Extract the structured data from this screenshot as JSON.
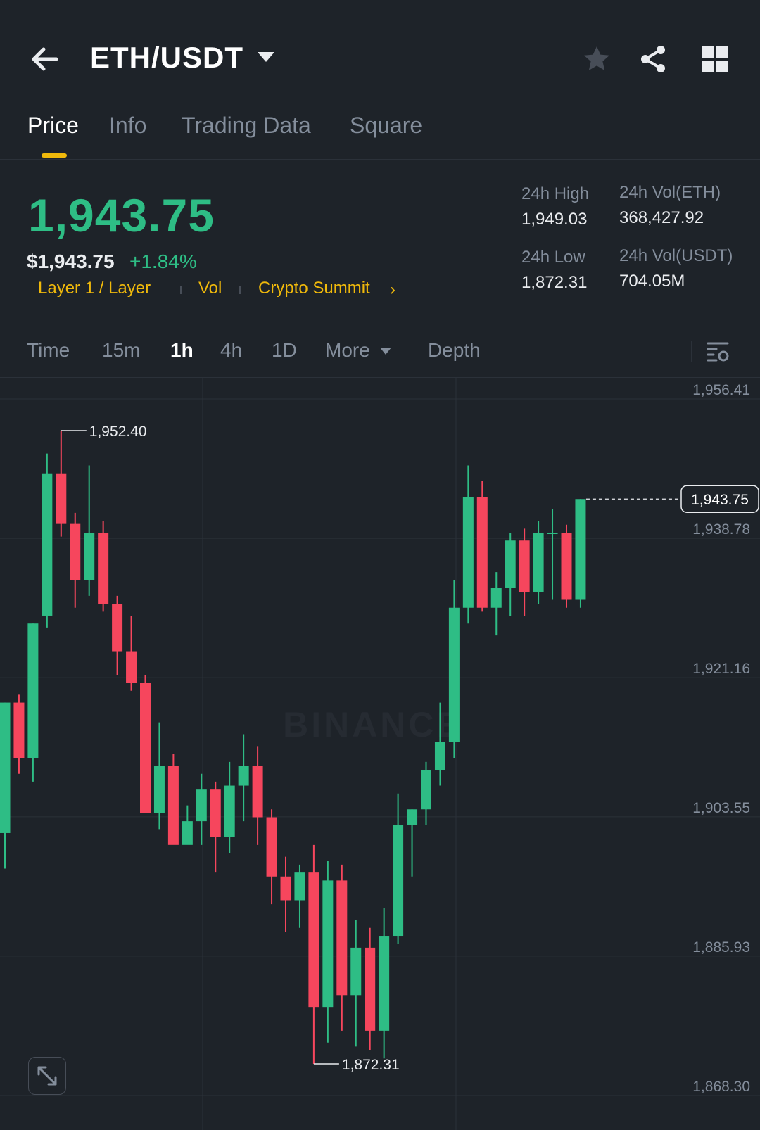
{
  "header": {
    "pair": "ETH/USDT",
    "icons": [
      "back-arrow-icon",
      "caret-down-icon",
      "star-icon",
      "share-icon",
      "grid-icon"
    ]
  },
  "tabs": [
    {
      "label": "Price",
      "active": true
    },
    {
      "label": "Info",
      "active": false
    },
    {
      "label": "Trading Data",
      "active": false
    },
    {
      "label": "Square",
      "active": false
    }
  ],
  "ticker": {
    "price": "1,943.75",
    "price_usd": "$1,943.75",
    "change": "+1.84%",
    "tags": [
      "Layer 1 / Layer",
      "Vol",
      "Crypto Summit"
    ],
    "stats": {
      "high_label": "24h High",
      "high_value": "1,949.03",
      "low_label": "24h Low",
      "low_value": "1,872.31",
      "vol_eth_label": "24h Vol(ETH)",
      "vol_eth_value": "368,427.92",
      "vol_usdt_label": "24h Vol(USDT)",
      "vol_usdt_value": "704.05M"
    }
  },
  "intervals": [
    {
      "label": "Time",
      "active": false
    },
    {
      "label": "15m",
      "active": false
    },
    {
      "label": "1h",
      "active": true
    },
    {
      "label": "4h",
      "active": false
    },
    {
      "label": "1D",
      "active": false
    },
    {
      "label": "More",
      "active": false
    },
    {
      "label": "Depth",
      "active": false
    }
  ],
  "colors": {
    "background": "#1e2329",
    "up": "#2ebd85",
    "down": "#f6465d",
    "accent": "#f0b90b",
    "muted": "#848e9c",
    "grid": "#2b3139"
  },
  "chart_data": {
    "type": "candlestick",
    "y_ticks": [
      "1,956.41",
      "1,938.78",
      "1,921.16",
      "1,903.55",
      "1,885.93",
      "1,868.30"
    ],
    "y_tick_values": [
      1956.41,
      1938.78,
      1921.16,
      1903.55,
      1885.93,
      1868.3
    ],
    "ylim": [
      1868.3,
      1956.41
    ],
    "current_price_label": "1,943.75",
    "current_price": 1943.75,
    "high_annotation": "1,952.40",
    "high_annotation_value": 1952.4,
    "low_annotation": "1,872.31",
    "low_annotation_value": 1872.31,
    "watermark": "BINANCE",
    "candles": [
      {
        "o": 1901.5,
        "h": 1918.0,
        "l": 1897.0,
        "c": 1918.0
      },
      {
        "o": 1918.0,
        "h": 1919.0,
        "l": 1909.0,
        "c": 1911.0
      },
      {
        "o": 1911.0,
        "h": 1928.0,
        "l": 1908.0,
        "c": 1928.0
      },
      {
        "o": 1929.0,
        "h": 1949.5,
        "l": 1927.5,
        "c": 1947.0
      },
      {
        "o": 1947.0,
        "h": 1952.4,
        "l": 1939.0,
        "c": 1940.6
      },
      {
        "o": 1940.6,
        "h": 1942.0,
        "l": 1930.0,
        "c": 1933.5
      },
      {
        "o": 1933.5,
        "h": 1948.0,
        "l": 1931.5,
        "c": 1939.5
      },
      {
        "o": 1939.5,
        "h": 1941.0,
        "l": 1929.5,
        "c": 1930.5
      },
      {
        "o": 1930.5,
        "h": 1931.5,
        "l": 1921.5,
        "c": 1924.5
      },
      {
        "o": 1924.5,
        "h": 1929.0,
        "l": 1919.5,
        "c": 1920.5
      },
      {
        "o": 1920.5,
        "h": 1921.5,
        "l": 1904.0,
        "c": 1904.0
      },
      {
        "o": 1904.0,
        "h": 1915.5,
        "l": 1902.0,
        "c": 1910.0
      },
      {
        "o": 1910.0,
        "h": 1911.5,
        "l": 1902.5,
        "c": 1900.0
      },
      {
        "o": 1900.0,
        "h": 1905.0,
        "l": 1902.5,
        "c": 1903.0
      },
      {
        "o": 1903.0,
        "h": 1909.0,
        "l": 1900.0,
        "c": 1907.0
      },
      {
        "o": 1907.0,
        "h": 1908.0,
        "l": 1896.5,
        "c": 1901.0
      },
      {
        "o": 1901.0,
        "h": 1910.5,
        "l": 1899.0,
        "c": 1907.5
      },
      {
        "o": 1907.5,
        "h": 1914.0,
        "l": 1903.0,
        "c": 1910.0
      },
      {
        "o": 1910.0,
        "h": 1912.5,
        "l": 1900.0,
        "c": 1903.5
      },
      {
        "o": 1903.5,
        "h": 1904.5,
        "l": 1892.5,
        "c": 1896.0
      },
      {
        "o": 1896.0,
        "h": 1898.5,
        "l": 1889.0,
        "c": 1893.0
      },
      {
        "o": 1893.0,
        "h": 1897.5,
        "l": 1889.5,
        "c": 1896.5
      },
      {
        "o": 1896.5,
        "h": 1900.0,
        "l": 1872.31,
        "c": 1879.5
      },
      {
        "o": 1879.5,
        "h": 1898.0,
        "l": 1875.0,
        "c": 1895.5
      },
      {
        "o": 1895.5,
        "h": 1897.5,
        "l": 1876.5,
        "c": 1881.0
      },
      {
        "o": 1881.0,
        "h": 1890.5,
        "l": 1874.5,
        "c": 1887.0
      },
      {
        "o": 1887.0,
        "h": 1889.5,
        "l": 1874.0,
        "c": 1876.5
      },
      {
        "o": 1876.5,
        "h": 1892.0,
        "l": 1873.0,
        "c": 1888.5
      },
      {
        "o": 1888.5,
        "h": 1906.5,
        "l": 1887.5,
        "c": 1902.5
      },
      {
        "o": 1902.5,
        "h": 1904.5,
        "l": 1896.0,
        "c": 1904.5
      },
      {
        "o": 1904.5,
        "h": 1910.5,
        "l": 1902.5,
        "c": 1909.5
      },
      {
        "o": 1909.5,
        "h": 1918.0,
        "l": 1907.5,
        "c": 1913.0
      },
      {
        "o": 1913.0,
        "h": 1933.5,
        "l": 1911.0,
        "c": 1930.0
      },
      {
        "o": 1930.0,
        "h": 1948.0,
        "l": 1928.0,
        "c": 1944.0
      },
      {
        "o": 1944.0,
        "h": 1946.0,
        "l": 1929.5,
        "c": 1930.0
      },
      {
        "o": 1930.0,
        "h": 1934.5,
        "l": 1926.5,
        "c": 1932.5
      },
      {
        "o": 1932.5,
        "h": 1939.5,
        "l": 1929.0,
        "c": 1938.5
      },
      {
        "o": 1938.5,
        "h": 1940.0,
        "l": 1929.0,
        "c": 1932.0
      },
      {
        "o": 1932.0,
        "h": 1941.0,
        "l": 1930.5,
        "c": 1939.5
      },
      {
        "o": 1939.5,
        "h": 1942.5,
        "l": 1931.0,
        "c": 1939.5
      },
      {
        "o": 1939.5,
        "h": 1940.5,
        "l": 1930.0,
        "c": 1931.0
      },
      {
        "o": 1931.0,
        "h": 1943.75,
        "l": 1930.0,
        "c": 1943.75
      }
    ]
  }
}
